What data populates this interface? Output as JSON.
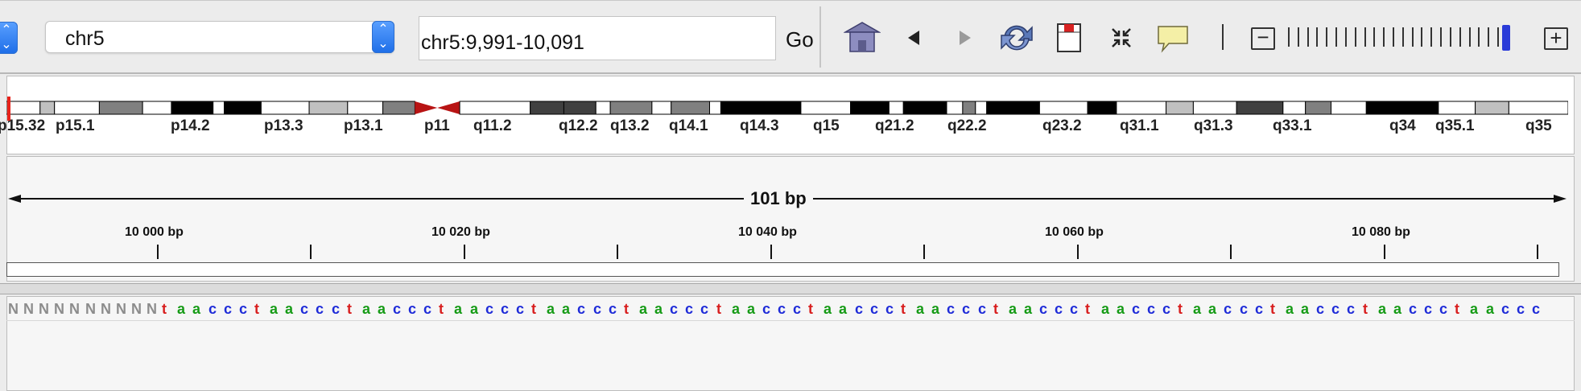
{
  "toolbar": {
    "genome_stepper": {
      "up": "⌃",
      "down": "⌄"
    },
    "chromosome": {
      "value": "chr5"
    },
    "locus": {
      "value": "chr5:9,991-10,091"
    },
    "go_label": "Go",
    "icons": [
      "home-icon",
      "back-icon",
      "forward-icon",
      "refresh-icon",
      "region-of-interest-icon",
      "resize-to-window-icon",
      "popup-text-icon"
    ],
    "zoom": {
      "minus": "−",
      "plus": "+",
      "level_fraction": 0.93
    }
  },
  "ideogram": {
    "bands": [
      {
        "name": "p15.32",
        "stain": "gneg"
      },
      {
        "name": "",
        "stain": "gpos25"
      },
      {
        "name": "p15.1",
        "stain": "gneg"
      },
      {
        "name": "",
        "stain": "gpos50"
      },
      {
        "name": "",
        "stain": "gneg"
      },
      {
        "name": "p14.2",
        "stain": "gpos100"
      },
      {
        "name": "",
        "stain": "gneg"
      },
      {
        "name": "",
        "stain": "gpos100"
      },
      {
        "name": "p13.3",
        "stain": "gneg"
      },
      {
        "name": "",
        "stain": "gpos25"
      },
      {
        "name": "p13.1",
        "stain": "gneg"
      },
      {
        "name": "",
        "stain": "gpos50"
      },
      {
        "name": "p11",
        "stain": "acen"
      },
      {
        "name": "q11.2",
        "stain": "gneg"
      },
      {
        "name": "",
        "stain": "gpos75"
      },
      {
        "name": "q12.2",
        "stain": "gpos75"
      },
      {
        "name": "",
        "stain": "gneg"
      },
      {
        "name": "q13.2",
        "stain": "gpos50"
      },
      {
        "name": "",
        "stain": "gneg"
      },
      {
        "name": "q14.1",
        "stain": "gpos50"
      },
      {
        "name": "",
        "stain": "gneg"
      },
      {
        "name": "q14.3",
        "stain": "gpos100"
      },
      {
        "name": "q15",
        "stain": "gneg"
      },
      {
        "name": "",
        "stain": "gpos100"
      },
      {
        "name": "q21.2",
        "stain": "gneg"
      },
      {
        "name": "",
        "stain": "gpos100"
      },
      {
        "name": "",
        "stain": "gneg"
      },
      {
        "name": "q22.2",
        "stain": "gpos50"
      },
      {
        "name": "",
        "stain": "gneg"
      },
      {
        "name": "",
        "stain": "gpos100"
      },
      {
        "name": "q23.2",
        "stain": "gneg"
      },
      {
        "name": "",
        "stain": "gpos100"
      },
      {
        "name": "q31.1",
        "stain": "gneg"
      },
      {
        "name": "",
        "stain": "gpos25"
      },
      {
        "name": "q31.3",
        "stain": "gneg"
      },
      {
        "name": "",
        "stain": "gpos75"
      },
      {
        "name": "q33.1",
        "stain": "gneg"
      },
      {
        "name": "",
        "stain": "gpos50"
      },
      {
        "name": "",
        "stain": "gneg"
      },
      {
        "name": "q34",
        "stain": "gpos100"
      },
      {
        "name": "q35.1",
        "stain": "gneg"
      },
      {
        "name": "",
        "stain": "gpos25"
      },
      {
        "name": "q35",
        "stain": "gneg"
      }
    ],
    "stain_colors": {
      "gneg": "#ffffff",
      "gpos25": "#c0c0c0",
      "gpos50": "#808080",
      "gpos75": "#404040",
      "gpos100": "#000000",
      "acen": "#b81414"
    }
  },
  "ruler": {
    "span_label": "101 bp",
    "start": 9991,
    "end": 10091,
    "ticks": [
      "10 000 bp",
      "10 020 bp",
      "10 040 bp",
      "10 060 bp",
      "10 080 bp"
    ],
    "tick_values": [
      10000,
      10020,
      10040,
      10060,
      10080
    ],
    "minor_values": [
      10010,
      10030,
      10050,
      10070,
      10090
    ]
  },
  "sequence": {
    "bases": "NNNNNNNNNNtaaccctaaccctaaccctaaccctaaccctaaccctaaccctaaccctaaccctaaccctaaccctaaccctaaccctaaccctaaccc",
    "colors": {
      "N": "#8c8c8c",
      "t": "#d81e1e",
      "a": "#169b16",
      "c": "#1e2bd8",
      "g": "#d1891e"
    }
  }
}
